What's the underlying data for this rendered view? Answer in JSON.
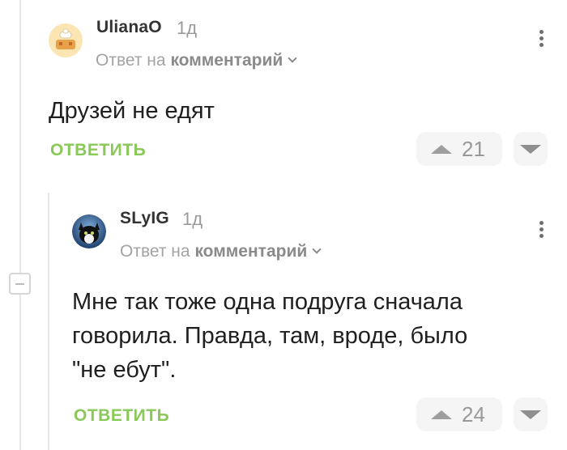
{
  "comments": [
    {
      "author": "UlianaO",
      "time": "1д",
      "reply_prefix": "Ответ на",
      "reply_target": "комментарий",
      "text": "Друзей не едят",
      "reply_label": "ОТВЕТИТЬ",
      "score": "21",
      "avatar_icon": "cartoon-avatar-icon"
    },
    {
      "author": "SLyIG",
      "time": "1д",
      "reply_prefix": "Ответ на",
      "reply_target": "комментарий",
      "text_lines": [
        "Мне так тоже одна подруга сначала",
        "говорила. Правда, там, вроде, было",
        "\"не ебут\"."
      ],
      "reply_label": "ОТВЕТИТЬ",
      "score": "24",
      "avatar_icon": "cat-avatar-icon"
    }
  ],
  "colors": {
    "accent": "#8ac858",
    "muted": "#9a9a9a",
    "pill": "#f5f5f5"
  }
}
